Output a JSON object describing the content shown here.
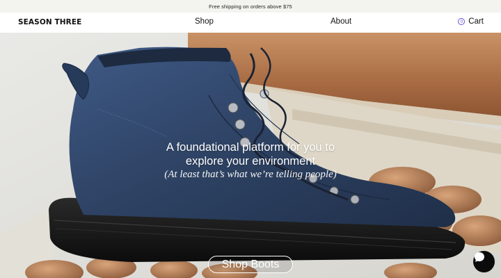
{
  "announcement": {
    "text": "Free shipping on orders above $75"
  },
  "header": {
    "logo": "SEASON THREE",
    "nav": [
      {
        "label": "Shop"
      },
      {
        "label": "About"
      }
    ],
    "cart": {
      "count": "0",
      "label": "Cart"
    }
  },
  "hero": {
    "headline_line1": "A foundational platform for you to",
    "headline_line2": "explore your environment",
    "subline": "(At least that’s what we’re telling people)",
    "cta_label": "Shop Boots"
  },
  "colors": {
    "accent": "#6b4fd8",
    "boot": "#2f4466",
    "wood": "#b9825a"
  },
  "icons": {
    "chat": "chat-bubble-icon",
    "hero_image": "blue-hiking-boot"
  }
}
